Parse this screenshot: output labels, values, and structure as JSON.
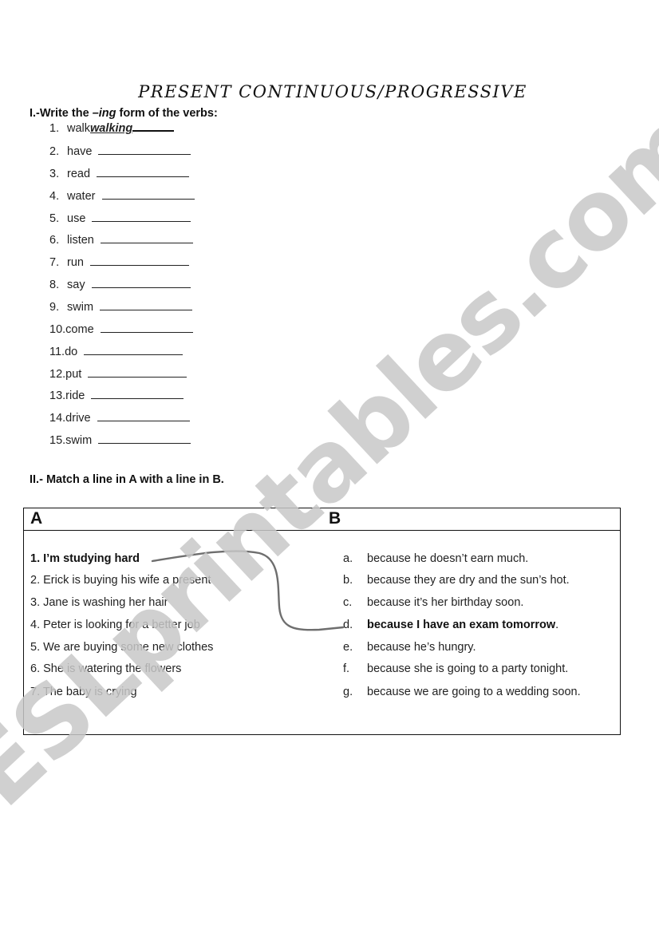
{
  "title": "PRESENT CONTINUOUS/PROGRESSIVE",
  "section1": {
    "heading_prefix": "I.-Write the ",
    "heading_italic": "–ing",
    "heading_suffix": " form of the verbs:",
    "items": [
      {
        "num": "1.",
        "verb": "walk",
        "answer": "walking"
      },
      {
        "num": "2.",
        "verb": "have",
        "answer": ""
      },
      {
        "num": "3.",
        "verb": "read",
        "answer": ""
      },
      {
        "num": "4.",
        "verb": "water",
        "answer": ""
      },
      {
        "num": "5.",
        "verb": "use",
        "answer": ""
      },
      {
        "num": "6.",
        "verb": "listen",
        "answer": ""
      },
      {
        "num": "7.",
        "verb": "run",
        "answer": ""
      },
      {
        "num": "8.",
        "verb": "say",
        "answer": ""
      },
      {
        "num": "9.",
        "verb": "swim",
        "answer": ""
      },
      {
        "num": "10.",
        "verb": "come",
        "answer": ""
      },
      {
        "num": "11.",
        "verb": "do",
        "answer": ""
      },
      {
        "num": "12.",
        "verb": "put",
        "answer": ""
      },
      {
        "num": "13.",
        "verb": "ride",
        "answer": ""
      },
      {
        "num": "14.",
        "verb": "drive",
        "answer": ""
      },
      {
        "num": "15.",
        "verb": "swim",
        "answer": ""
      }
    ]
  },
  "section2": {
    "heading": "II.- Match a line in A with a line in B.",
    "col_a_header": "A",
    "col_b_header": "B",
    "col_a": [
      "1. I’m studying hard",
      "2. Erick is buying his wife a present",
      "3. Jane is washing her hair",
      "4. Peter is looking for a better job",
      "5. We are buying some new clothes",
      "6. She is watering the flowers",
      "7. The baby is crying"
    ],
    "col_b": [
      {
        "letter": "a.",
        "text": "because he doesn’t earn much."
      },
      {
        "letter": "b.",
        "text": "because they are dry and the sun’s hot."
      },
      {
        "letter": "c.",
        "text": "because it’s her birthday soon."
      },
      {
        "letter": "d.",
        "text": "because I have an exam tomorrow",
        "tail": "."
      },
      {
        "letter": "e.",
        "text": "because he’s hungry."
      },
      {
        "letter": "f.",
        "text": "because she is going to a party tonight."
      },
      {
        "letter": "g.",
        "text": "because we are going to a wedding soon."
      }
    ],
    "example_match": {
      "from": "1",
      "to": "d"
    }
  },
  "watermark": "ESLprintables.com",
  "colors": {
    "text": "#111111",
    "watermark": "#c8c8c8",
    "connector": "#6e6e6e"
  }
}
